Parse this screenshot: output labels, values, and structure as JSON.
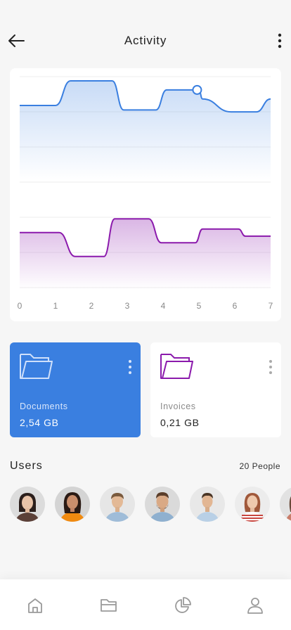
{
  "header": {
    "title": "Activity"
  },
  "chart_data": {
    "type": "area",
    "x": [
      0,
      1,
      2,
      3,
      4,
      5,
      6,
      7
    ],
    "xlim": [
      0,
      7
    ],
    "grid": true,
    "series": [
      {
        "color": "#3a7fe0",
        "points": [
          [
            0,
            0.62
          ],
          [
            1,
            0.62
          ],
          [
            1.42,
            1.0
          ],
          [
            2.58,
            1.0
          ],
          [
            2.9,
            0.55
          ],
          [
            3.8,
            0.55
          ],
          [
            4.1,
            0.86
          ],
          [
            5.0,
            0.86
          ],
          [
            5.1,
            0.72
          ],
          [
            5.9,
            0.52
          ],
          [
            6.6,
            0.52
          ],
          [
            7,
            0.72
          ]
        ],
        "highlight_x": 4.95
      },
      {
        "color": "#8b1aac",
        "points": [
          [
            0,
            0.72
          ],
          [
            1.1,
            0.72
          ],
          [
            1.55,
            0.32
          ],
          [
            2.35,
            0.32
          ],
          [
            2.65,
            0.95
          ],
          [
            3.6,
            0.95
          ],
          [
            3.95,
            0.55
          ],
          [
            4.9,
            0.55
          ],
          [
            5.1,
            0.78
          ],
          [
            6.1,
            0.78
          ],
          [
            6.3,
            0.66
          ],
          [
            7,
            0.66
          ]
        ]
      }
    ]
  },
  "files": [
    {
      "label": "Documents",
      "size": "2,54 GB",
      "color": "#3a7fe0"
    },
    {
      "label": "Invoices",
      "size": "0,21 GB",
      "color": "#8b1aac"
    }
  ],
  "users": {
    "title": "Users",
    "count": "20 People"
  },
  "colors": {
    "accent_blue": "#3a7fe0",
    "accent_purple": "#8b1aac"
  },
  "nav": [
    "home-icon",
    "folder-icon",
    "pie-chart-icon",
    "user-icon"
  ]
}
